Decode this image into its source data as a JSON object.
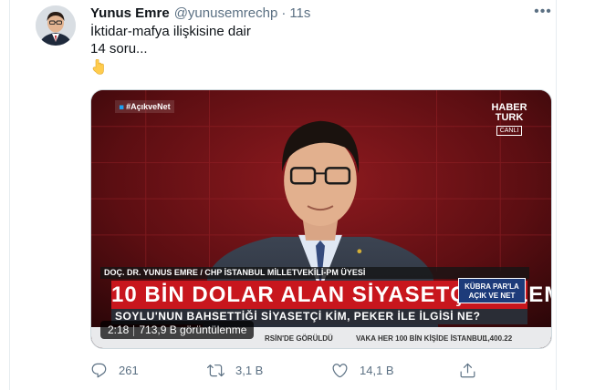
{
  "tweet": {
    "author_name": "Yunus Emre",
    "handle": "@yunusemrechp",
    "separator": "·",
    "time": "11s",
    "more_label": "•••",
    "text_lines": [
      "İktidar-mafya ilişkisine dair",
      "14 soru..."
    ],
    "emoji": "backhand-index-pointing-down"
  },
  "video": {
    "hashtag": "#AçıkveNet",
    "channel_logo_line1": "HABER",
    "channel_logo_line2": "TURK",
    "channel_live": "CANLI",
    "name_strap": "DOÇ. DR. YUNUS EMRE / CHP İSTANBUL MİLLETVEKİLİ-PM ÜYESİ",
    "headline": "10 BİN DOLAR ALAN SİYASETÇİ POLEMİĞİ",
    "program_badge_line1": "KÜBRA PAR'LA",
    "program_badge_line2": "AÇIK VE NET",
    "subheadline": "SOYLU'NUN BAHSETTİĞİ SİYASETÇİ KİM, PEKER İLE İLGİSİ NE?",
    "ticker_1": "RSİN'DE GÖRÜLDÜ",
    "ticker_2": "VAKA HER 100 BİN KİŞİDE İSTANBUL",
    "ticker_3": "1,400.22",
    "duration": "2:18",
    "views": "713,9 B görüntülenme"
  },
  "actions": {
    "reply_count": "261",
    "retweet_count": "3,1 B",
    "like_count": "14,1 B",
    "icons": [
      "reply-icon",
      "retweet-icon",
      "like-icon",
      "share-icon"
    ]
  },
  "colors": {
    "text_primary": "#0f1419",
    "text_secondary": "#5b7083",
    "headline_red": "#c8161d",
    "badge_blue": "#1d3b7a"
  }
}
